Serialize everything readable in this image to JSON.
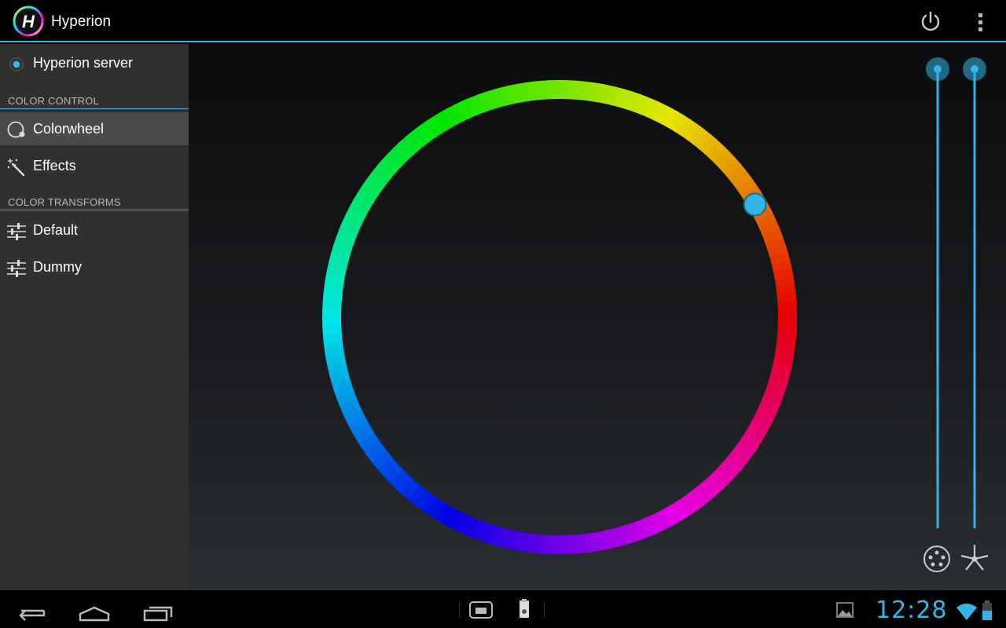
{
  "actionbar": {
    "title": "Hyperion",
    "logo_icon": "hyperion-logo-icon",
    "power_icon": "power-icon",
    "overflow_icon": "overflow-menu-icon"
  },
  "sidebar": {
    "server": {
      "label": "Hyperion server",
      "icon": "radio-selected-icon"
    },
    "sections": [
      {
        "header": "COLOR CONTROL",
        "items": [
          {
            "label": "Colorwheel",
            "icon": "colorwheel-icon",
            "selected": true
          },
          {
            "label": "Effects",
            "icon": "magic-wand-icon",
            "selected": false
          }
        ]
      },
      {
        "header": "COLOR TRANSFORMS",
        "items": [
          {
            "label": "Default",
            "icon": "sliders-icon",
            "selected": false
          },
          {
            "label": "Dummy",
            "icon": "sliders-icon",
            "selected": false
          }
        ]
      }
    ]
  },
  "colorwheel": {
    "selected_hue_deg": 30,
    "selector_color": "#33b5e5"
  },
  "sliders": {
    "brightness": {
      "value": 1.0,
      "icon": "brightness-dots-icon"
    },
    "saturation": {
      "value": 1.0,
      "icon": "saturation-star-icon"
    },
    "accent": "#33b5e5"
  },
  "systembar": {
    "clock": "12:28",
    "nav": [
      "back-icon",
      "home-icon",
      "recent-apps-icon"
    ],
    "center_icons": [
      "screenshot-icon",
      "usb-storage-icon"
    ],
    "status_icons": [
      "gallery-notification-icon",
      "wifi-icon",
      "battery-icon"
    ]
  }
}
